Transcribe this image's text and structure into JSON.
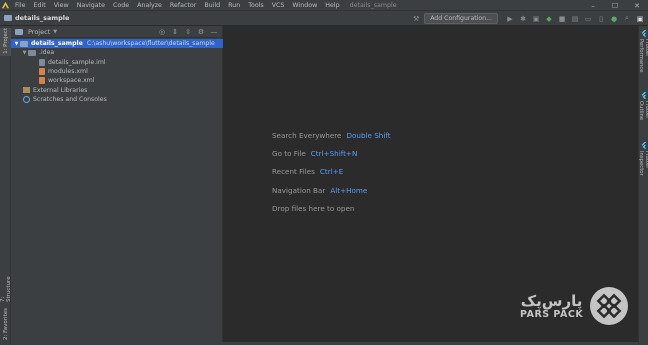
{
  "menubar": {
    "items": [
      "File",
      "Edit",
      "View",
      "Navigate",
      "Code",
      "Analyze",
      "Refactor",
      "Build",
      "Run",
      "Tools",
      "VCS",
      "Window",
      "Help"
    ],
    "window_title": "details_sample",
    "controls": [
      "–",
      "☐",
      "✕"
    ]
  },
  "navbar": {
    "breadcrumb": "details_sample",
    "add_configuration": "Add Configuration..."
  },
  "left_stripe": {
    "project_tab": "1: Project",
    "structure_tab": "7: Structure",
    "favorites_tab": "2: Favorites"
  },
  "right_stripe": {
    "tabs": [
      "Flutter Performance",
      "Flutter Outline",
      "Flutter Inspector"
    ]
  },
  "project_panel": {
    "title": "Project",
    "tree": [
      {
        "label": "details_sample",
        "path": "C:\\ashu\\workspace\\flutter\\details_sample"
      },
      {
        "label": ".idea"
      },
      {
        "label": "details_sample.iml"
      },
      {
        "label": "modules.xml"
      },
      {
        "label": "workspace.xml"
      },
      {
        "label": "External Libraries"
      },
      {
        "label": "Scratches and Consoles"
      }
    ]
  },
  "editor": {
    "hints": [
      {
        "label": "Search Everywhere",
        "key": "Double Shift"
      },
      {
        "label": "Go to File",
        "key": "Ctrl+Shift+N"
      },
      {
        "label": "Recent Files",
        "key": "Ctrl+E"
      },
      {
        "label": "Navigation Bar",
        "key": "Alt+Home"
      },
      {
        "label": "Drop files here to open",
        "key": ""
      }
    ]
  },
  "watermark": {
    "fa": "پارس‌پک",
    "en": "PARS PACK"
  },
  "colors": {
    "selection": "#2f65ca",
    "shortcut": "#589df6",
    "panel": "#3c3f41",
    "editor": "#2b2b2b"
  }
}
